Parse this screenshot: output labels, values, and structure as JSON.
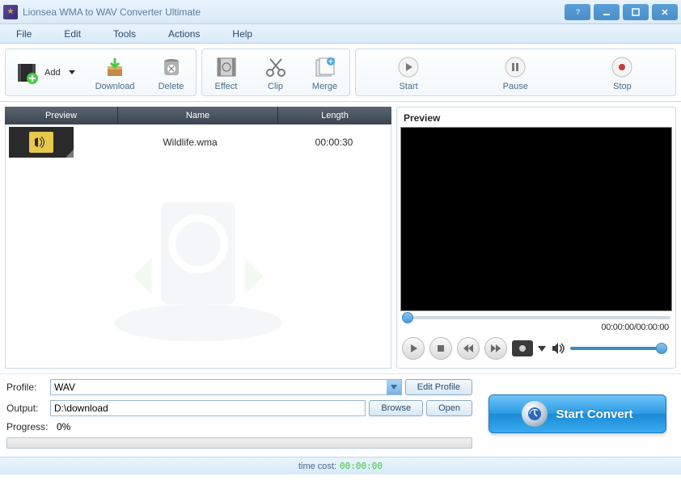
{
  "title": "Lionsea WMA to WAV Converter Ultimate",
  "menu": {
    "file": "File",
    "edit": "Edit",
    "tools": "Tools",
    "actions": "Actions",
    "help": "Help"
  },
  "toolbar": {
    "add": "Add",
    "download": "Download",
    "delete": "Delete",
    "effect": "Effect",
    "clip": "Clip",
    "merge": "Merge",
    "start": "Start",
    "pause": "Pause",
    "stop": "Stop"
  },
  "list": {
    "headers": {
      "preview": "Preview",
      "name": "Name",
      "length": "Length"
    },
    "rows": [
      {
        "name": "Wildlife.wma",
        "length": "00:00:30"
      }
    ]
  },
  "preview": {
    "title": "Preview",
    "time": "00:00:00/00:00:00"
  },
  "form": {
    "profile_label": "Profile:",
    "profile_value": "WAV",
    "edit_profile": "Edit Profile",
    "output_label": "Output:",
    "output_value": "D:\\download",
    "browse": "Browse",
    "open": "Open",
    "progress_label": "Progress:",
    "progress_value": "0%"
  },
  "convert": "Start Convert",
  "status": {
    "label": "time cost:",
    "value": "00:00:00"
  }
}
